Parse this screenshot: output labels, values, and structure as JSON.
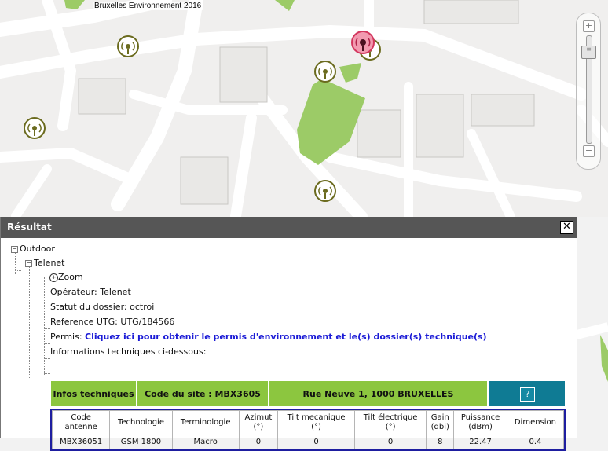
{
  "map": {
    "copyright": "Bruxelles Environnement 2016",
    "zoom_in": "+",
    "zoom_out": "−",
    "slider_glyph": "≡",
    "selected_marker": "selected-antenna"
  },
  "panel": {
    "title": "Résultat",
    "close_label": "✕",
    "tree": {
      "root": "Outdoor",
      "operator_node": "Telenet",
      "zoom_label": "Zoom",
      "operateur_label": "Opérateur:",
      "operateur_value": "Telenet",
      "statut_label": "Statut du dossier:",
      "statut_value": "octroi",
      "reference_label": "Reference UTG:",
      "reference_value": "UTG/184566",
      "permis_label": "Permis:",
      "permis_link": "Cliquez ici pour obtenir le permis d'environnement et le(s) dossier(s) technique(s)",
      "info_label": "Informations techniques ci-dessous:"
    },
    "info_bar": {
      "infos": "Infos techniques",
      "code_site": "Code du site : MBX3605",
      "address": "Rue Neuve 1, 1000 BRUXELLES",
      "help": "?"
    },
    "table": {
      "headers": [
        [
          "Code",
          "antenne"
        ],
        [
          "Technologie",
          ""
        ],
        [
          "Terminologie",
          ""
        ],
        [
          "Azimut",
          "(°)"
        ],
        [
          "Tilt mecanique",
          "(°)"
        ],
        [
          "Tilt électrique",
          "(°)"
        ],
        [
          "Gain",
          "(dbi)"
        ],
        [
          "Puissance",
          "(dBm)"
        ],
        [
          "Dimension",
          ""
        ]
      ],
      "rows": [
        [
          "MBX36051",
          "GSM 1800",
          "Macro",
          "0",
          "0",
          "0",
          "8",
          "22.47",
          "0.4"
        ]
      ]
    }
  }
}
